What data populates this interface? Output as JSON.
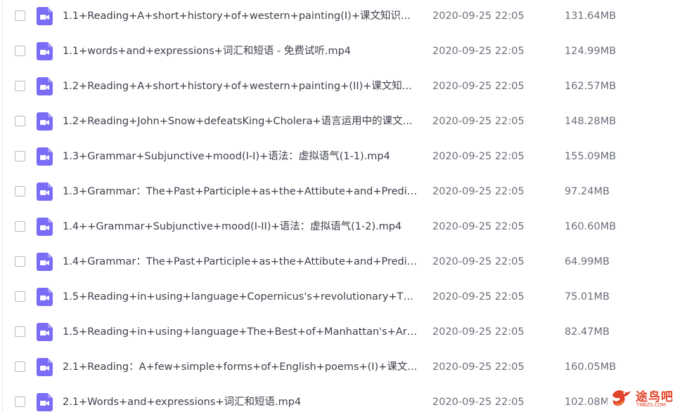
{
  "files": [
    {
      "name": "1.1+Reading+A+short+history+of+western+painting(I)+课文知识...",
      "date": "2020-09-25 22:05",
      "size": "131.64MB"
    },
    {
      "name": "1.1+words+and+expressions+词汇和短语 - 免费试听.mp4",
      "date": "2020-09-25 22:05",
      "size": "124.99MB"
    },
    {
      "name": "1.2+Reading+A+short+history+of+western+painting+(II)+课文知...",
      "date": "2020-09-25 22:05",
      "size": "162.57MB"
    },
    {
      "name": "1.2+Reading+John+Snow+defeatsKing+Cholera+语言运用中的课文...",
      "date": "2020-09-25 22:05",
      "size": "148.28MB"
    },
    {
      "name": "1.3+Grammar+Subjunctive+mood(I-I)+语法：虚拟语气(1-1).mp4",
      "date": "2020-09-25 22:05",
      "size": "155.09MB"
    },
    {
      "name": "1.3+Grammar：The+Past+Participle+as+the+Attibute+and+Predic...",
      "date": "2020-09-25 22:05",
      "size": "97.24MB"
    },
    {
      "name": "1.4++Grammar+Subjunctive+mood(I-II)+语法：虚拟语气(1-2).mp4",
      "date": "2020-09-25 22:05",
      "size": "160.60MB"
    },
    {
      "name": "1.4+Grammar：The+Past+Participle+as+the+Attibute+and+Predic...",
      "date": "2020-09-25 22:05",
      "size": "64.99MB"
    },
    {
      "name": "1.5+Reading+in+using+language+Copernicus's+revolutionary+Th...",
      "date": "2020-09-25 22:05",
      "size": "75.01MB"
    },
    {
      "name": "1.5+Reading+in+using+language+The+Best+of+Manhattan's+Art...",
      "date": "2020-09-25 22:05",
      "size": "82.47MB"
    },
    {
      "name": "2.1+Reading：A+few+simple+forms+of+English+poems+(I)+课文...",
      "date": "2020-09-25 22:05",
      "size": "160.05MB"
    },
    {
      "name": "2.1+Words+and+expressions+词汇和短语.mp4",
      "date": "2020-09-25 22:05",
      "size": "102.08MB"
    }
  ],
  "icons": {
    "file": "video-file-icon",
    "checkbox": "checkbox-icon",
    "watermark_logo": "bird-logo-icon"
  },
  "colors": {
    "video_icon": "#7b6cf6",
    "watermark": "#e0442a"
  },
  "watermark": {
    "title": "途鸟吧",
    "url": "TNBZS.COM"
  }
}
